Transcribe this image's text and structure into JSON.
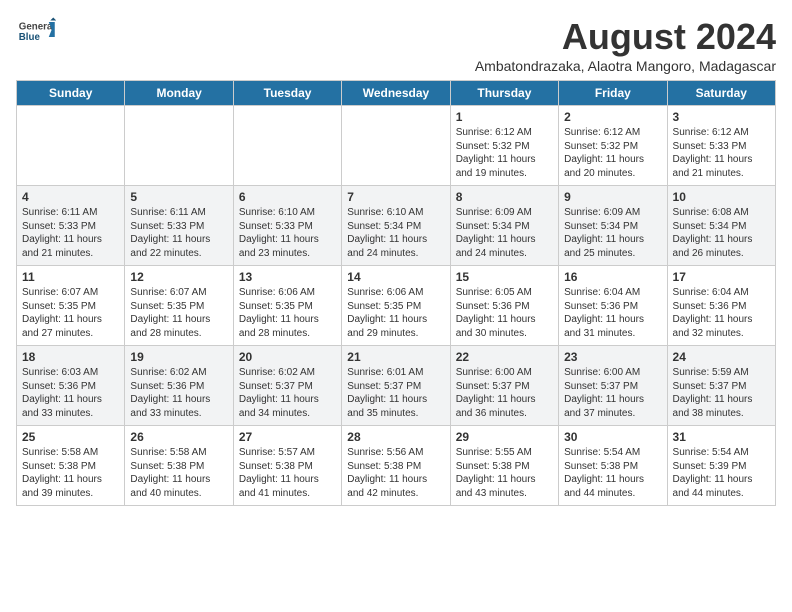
{
  "header": {
    "logo_general": "General",
    "logo_blue": "Blue",
    "month_year": "August 2024",
    "location": "Ambatondrazaka, Alaotra Mangoro, Madagascar"
  },
  "weekdays": [
    "Sunday",
    "Monday",
    "Tuesday",
    "Wednesday",
    "Thursday",
    "Friday",
    "Saturday"
  ],
  "weeks": [
    [
      {
        "day": "",
        "info": ""
      },
      {
        "day": "",
        "info": ""
      },
      {
        "day": "",
        "info": ""
      },
      {
        "day": "",
        "info": ""
      },
      {
        "day": "1",
        "info": "Sunrise: 6:12 AM\nSunset: 5:32 PM\nDaylight: 11 hours and 19 minutes."
      },
      {
        "day": "2",
        "info": "Sunrise: 6:12 AM\nSunset: 5:32 PM\nDaylight: 11 hours and 20 minutes."
      },
      {
        "day": "3",
        "info": "Sunrise: 6:12 AM\nSunset: 5:33 PM\nDaylight: 11 hours and 21 minutes."
      }
    ],
    [
      {
        "day": "4",
        "info": "Sunrise: 6:11 AM\nSunset: 5:33 PM\nDaylight: 11 hours and 21 minutes."
      },
      {
        "day": "5",
        "info": "Sunrise: 6:11 AM\nSunset: 5:33 PM\nDaylight: 11 hours and 22 minutes."
      },
      {
        "day": "6",
        "info": "Sunrise: 6:10 AM\nSunset: 5:33 PM\nDaylight: 11 hours and 23 minutes."
      },
      {
        "day": "7",
        "info": "Sunrise: 6:10 AM\nSunset: 5:34 PM\nDaylight: 11 hours and 24 minutes."
      },
      {
        "day": "8",
        "info": "Sunrise: 6:09 AM\nSunset: 5:34 PM\nDaylight: 11 hours and 24 minutes."
      },
      {
        "day": "9",
        "info": "Sunrise: 6:09 AM\nSunset: 5:34 PM\nDaylight: 11 hours and 25 minutes."
      },
      {
        "day": "10",
        "info": "Sunrise: 6:08 AM\nSunset: 5:34 PM\nDaylight: 11 hours and 26 minutes."
      }
    ],
    [
      {
        "day": "11",
        "info": "Sunrise: 6:07 AM\nSunset: 5:35 PM\nDaylight: 11 hours and 27 minutes."
      },
      {
        "day": "12",
        "info": "Sunrise: 6:07 AM\nSunset: 5:35 PM\nDaylight: 11 hours and 28 minutes."
      },
      {
        "day": "13",
        "info": "Sunrise: 6:06 AM\nSunset: 5:35 PM\nDaylight: 11 hours and 28 minutes."
      },
      {
        "day": "14",
        "info": "Sunrise: 6:06 AM\nSunset: 5:35 PM\nDaylight: 11 hours and 29 minutes."
      },
      {
        "day": "15",
        "info": "Sunrise: 6:05 AM\nSunset: 5:36 PM\nDaylight: 11 hours and 30 minutes."
      },
      {
        "day": "16",
        "info": "Sunrise: 6:04 AM\nSunset: 5:36 PM\nDaylight: 11 hours and 31 minutes."
      },
      {
        "day": "17",
        "info": "Sunrise: 6:04 AM\nSunset: 5:36 PM\nDaylight: 11 hours and 32 minutes."
      }
    ],
    [
      {
        "day": "18",
        "info": "Sunrise: 6:03 AM\nSunset: 5:36 PM\nDaylight: 11 hours and 33 minutes."
      },
      {
        "day": "19",
        "info": "Sunrise: 6:02 AM\nSunset: 5:36 PM\nDaylight: 11 hours and 33 minutes."
      },
      {
        "day": "20",
        "info": "Sunrise: 6:02 AM\nSunset: 5:37 PM\nDaylight: 11 hours and 34 minutes."
      },
      {
        "day": "21",
        "info": "Sunrise: 6:01 AM\nSunset: 5:37 PM\nDaylight: 11 hours and 35 minutes."
      },
      {
        "day": "22",
        "info": "Sunrise: 6:00 AM\nSunset: 5:37 PM\nDaylight: 11 hours and 36 minutes."
      },
      {
        "day": "23",
        "info": "Sunrise: 6:00 AM\nSunset: 5:37 PM\nDaylight: 11 hours and 37 minutes."
      },
      {
        "day": "24",
        "info": "Sunrise: 5:59 AM\nSunset: 5:37 PM\nDaylight: 11 hours and 38 minutes."
      }
    ],
    [
      {
        "day": "25",
        "info": "Sunrise: 5:58 AM\nSunset: 5:38 PM\nDaylight: 11 hours and 39 minutes."
      },
      {
        "day": "26",
        "info": "Sunrise: 5:58 AM\nSunset: 5:38 PM\nDaylight: 11 hours and 40 minutes."
      },
      {
        "day": "27",
        "info": "Sunrise: 5:57 AM\nSunset: 5:38 PM\nDaylight: 11 hours and 41 minutes."
      },
      {
        "day": "28",
        "info": "Sunrise: 5:56 AM\nSunset: 5:38 PM\nDaylight: 11 hours and 42 minutes."
      },
      {
        "day": "29",
        "info": "Sunrise: 5:55 AM\nSunset: 5:38 PM\nDaylight: 11 hours and 43 minutes."
      },
      {
        "day": "30",
        "info": "Sunrise: 5:54 AM\nSunset: 5:38 PM\nDaylight: 11 hours and 44 minutes."
      },
      {
        "day": "31",
        "info": "Sunrise: 5:54 AM\nSunset: 5:39 PM\nDaylight: 11 hours and 44 minutes."
      }
    ]
  ]
}
